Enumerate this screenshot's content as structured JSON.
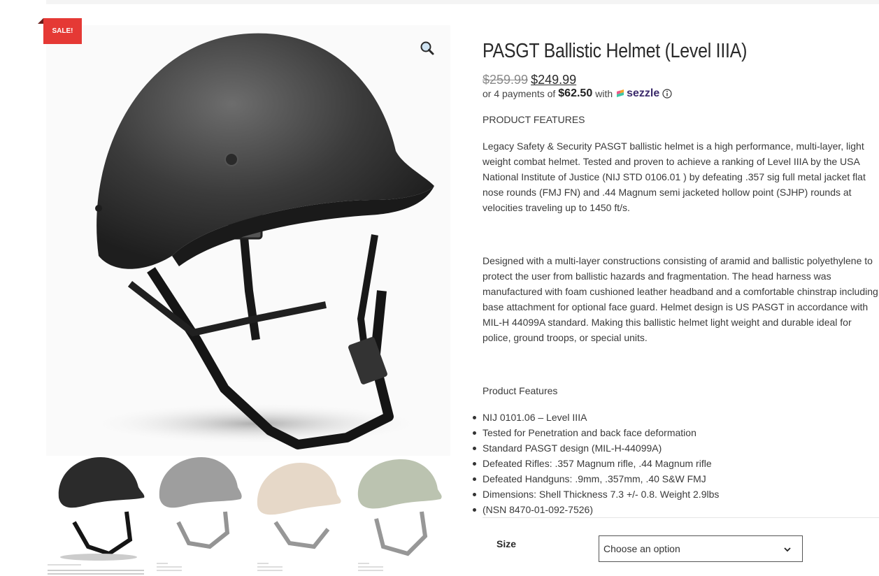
{
  "badge": {
    "sale": "SALE!"
  },
  "product": {
    "title": "PASGT Ballistic Helmet (Level IIIA)",
    "price_old": "$259.99",
    "price_new": "$249.99",
    "installments_prefix": "or 4 payments of",
    "installment_amount": "$62.50",
    "installments_with": "with",
    "payment_brand": "sezzle",
    "features_heading": "PRODUCT FEATURES",
    "description_1": "Legacy Safety & Security PASGT ballistic helmet is a high performance, multi-layer, light weight combat helmet. Tested and proven to achieve a ranking of Level IIIA by the USA National Institute of Justice (NIJ STD 0106.01 ) by defeating .357 sig full metal jacket flat nose rounds (FMJ FN) and .44 Magnum semi jacketed hollow point (SJHP) rounds at velocities traveling up to 1450 ft/s.",
    "description_2": "Designed with a multi-layer constructions consisting of aramid and ballistic polyethylene to protect the user from ballistic hazards and fragmentation. The head harness was manufactured with foam cushioned leather headband and a comfortable chinstrap including base attachment for optional face guard. Helmet design is US PASGT in accordance with MIL-H 44099A standard. Making this ballistic helmet light weight and durable ideal for police, ground troops, or special units.",
    "features_heading_2": "Product Features",
    "features": [
      "NIJ 0101.06 – Level IIIA",
      "Tested for Penetration and back face deformation",
      "Standard PASGT design (MIL-H-44099A)",
      "Defeated Rifles: .357 Magnum rifle, .44 Magnum rifle",
      "Defeated Handguns: .9mm, .357mm, .40 S&W FMJ",
      "Dimensions: Shell Thickness 7.3 +/- 0.8. Weight 2.9lbs",
      "(NSN 8470-01-092-7526)"
    ]
  },
  "variations": {
    "size_label": "Size",
    "size_placeholder": "Choose an option"
  },
  "gallery": {
    "thumbnails": [
      {
        "color": "#2b2b2b",
        "active": true
      },
      {
        "color": "#2b2b2b",
        "active": false
      },
      {
        "color": "#c9ab86",
        "active": false
      },
      {
        "color": "#6b7b52",
        "active": false
      }
    ]
  },
  "colors": {
    "sale_badge": "#e53935",
    "sezzle_brand": "#3b2a6b"
  }
}
